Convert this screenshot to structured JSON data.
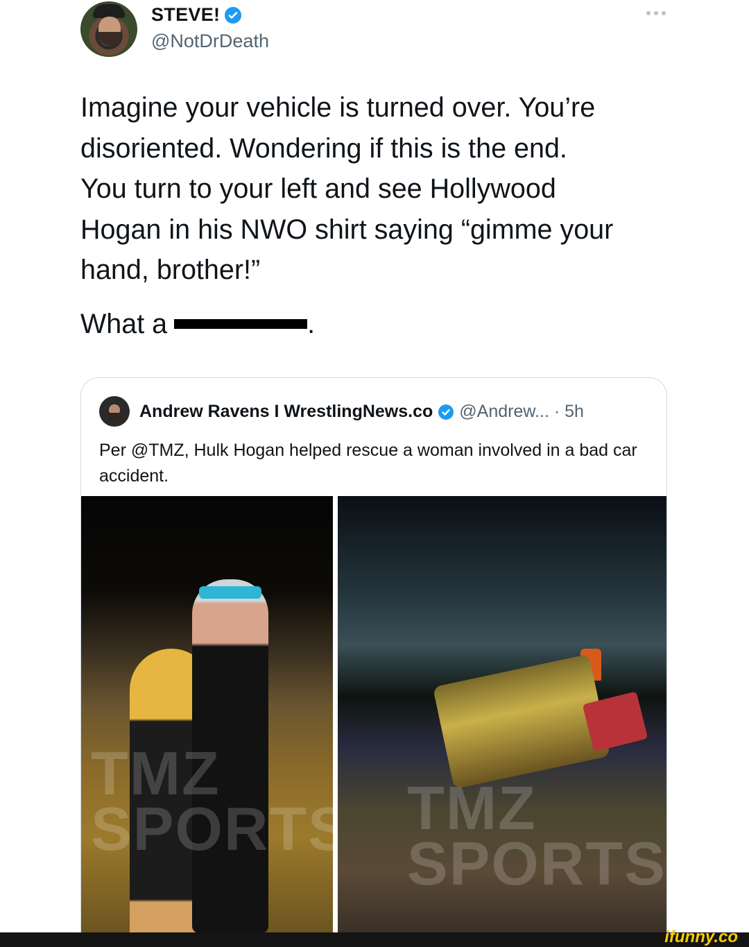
{
  "tweet": {
    "display_name": "STEVE!",
    "handle": "@NotDrDeath",
    "text": "Imagine your vehicle is turned over. You’re\ndisoriented. Wondering if this is the end.\nYou turn to your left and see Hollywood\nHogan in his NWO shirt saying “gimme your\nhand, brother!”",
    "text_line2_prefix": "What a",
    "text_line2_suffix": "."
  },
  "quote": {
    "name": "Andrew Ravens I WrestlingNews.co",
    "meta": "@Andrew... · 5h",
    "text": "Per @TMZ, Hulk Hogan helped rescue a woman involved in a bad car accident.",
    "watermark_left": "TMZ\nSPORTS",
    "watermark_right": "TMZ\nSPORTS"
  },
  "brand": {
    "label": "ifunny.co"
  },
  "colors": {
    "verified": "#1d9bf0",
    "secondary_text": "#536471",
    "brand_yellow": "#ffcc00"
  },
  "icons": {
    "verified": "verified-badge-icon",
    "more": "more-dots-icon"
  }
}
